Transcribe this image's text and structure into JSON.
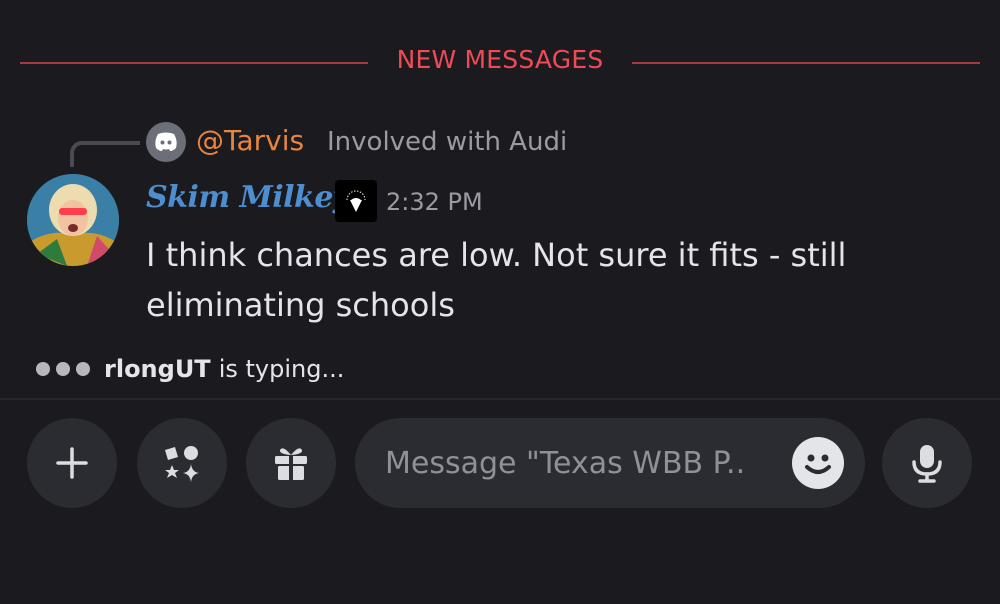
{
  "divider": {
    "label": "NEW MESSAGES"
  },
  "reply": {
    "author": "@Tarvis",
    "snippet": "Involved with Audi"
  },
  "message": {
    "author": "Skim Milkey",
    "time": "2:32 PM",
    "text": "I think chances are low. Not sure it fits - still eliminating schools"
  },
  "typing": {
    "user": "rlongUT",
    "suffix": "is typing..."
  },
  "composer": {
    "placeholder": "Message \"Texas WBB P.."
  },
  "icons": {
    "reply": "discord-icon",
    "add": "plus-icon",
    "apps": "apps-icon",
    "gift": "gift-icon",
    "emoji": "smiley-icon",
    "mic": "microphone-icon"
  },
  "colors": {
    "background": "#1b1b1f",
    "divider": "#ef4a56",
    "reply_author": "#e8843e",
    "username": "#4c8ed0",
    "button_bg": "#2b2c31"
  }
}
